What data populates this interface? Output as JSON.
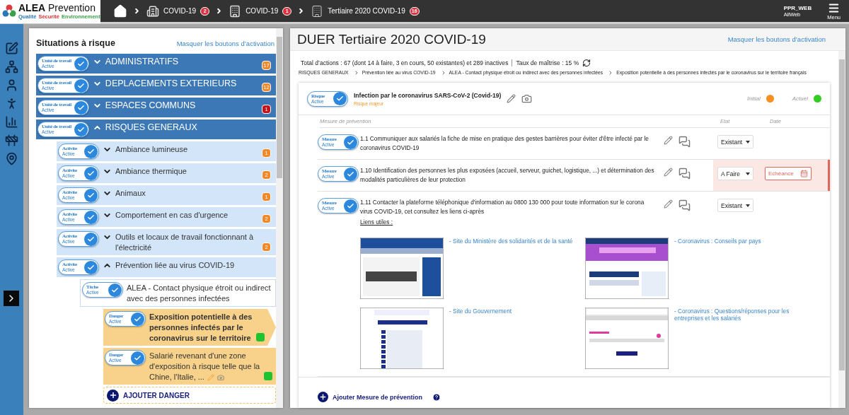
{
  "topbar": {
    "logo": {
      "name": "**ALEA** Prevention",
      "tagline": [
        {
          "text": "Qualité",
          "color": "#2a78b8"
        },
        {
          "text": "Sécurité",
          "color": "#d9343a"
        },
        {
          "text": "Environnement",
          "color": "#3aa04a"
        }
      ]
    },
    "breadcrumbs": [
      {
        "label": "COVID-19",
        "count": "2"
      },
      {
        "label": "COVID-19",
        "count": "1"
      },
      {
        "label": "Tertiaire 2020 COVID-19",
        "count": "16"
      }
    ],
    "user": {
      "login": "PPR_WEB",
      "org": "AllWeb"
    },
    "menu_label": "Menu"
  },
  "left_panel": {
    "title": "Situations à risque",
    "hide_link": "Masquer les boutons d’activation",
    "units": [
      {
        "kind": "unit",
        "toggle": {
          "label": "Unité de travail",
          "status": "Active",
          "on": true
        },
        "name": "ADMINISTRATIFS",
        "expanded": false,
        "count": "17",
        "color": "#f0892a"
      },
      {
        "kind": "unit",
        "toggle": {
          "label": "Unité de travail",
          "status": "Active",
          "on": true
        },
        "name": "DEPLACEMENTS EXTERIEURS",
        "expanded": false,
        "count": "12",
        "color": "#f0892a"
      },
      {
        "kind": "unit",
        "toggle": {
          "label": "Unité de travail",
          "status": "Active",
          "on": true
        },
        "name": "ESPACES COMMUNS",
        "expanded": false,
        "count": "1",
        "color": "#c3161c"
      },
      {
        "kind": "unit",
        "toggle": {
          "label": "Unité de travail",
          "status": "Active",
          "on": true
        },
        "name": "RISQUES GENERAUX",
        "expanded": true,
        "children": [
          {
            "kind": "activity",
            "toggle": {
              "label": "Activite",
              "status": "Active",
              "on": true
            },
            "name": "Ambiance lumineuse",
            "expanded": false,
            "count": "1",
            "color": "#f0892a"
          },
          {
            "kind": "activity",
            "toggle": {
              "label": "Activite",
              "status": "Active",
              "on": true
            },
            "name": "Ambiance thermique",
            "expanded": false,
            "count": "2",
            "color": "#f0892a"
          },
          {
            "kind": "activity",
            "toggle": {
              "label": "Activite",
              "status": "Active",
              "on": true
            },
            "name": "Animaux",
            "expanded": false,
            "count": "1",
            "color": "#f0892a"
          },
          {
            "kind": "activity",
            "toggle": {
              "label": "Activite",
              "status": "Active",
              "on": true
            },
            "name": "Comportement en cas d'urgence",
            "expanded": false,
            "count": "2",
            "color": "#f0892a"
          },
          {
            "kind": "activity",
            "toggle": {
              "label": "Activite",
              "status": "Active",
              "on": true
            },
            "name": "Outils et locaux de travail fonctionnant à l'électricité",
            "expanded": false,
            "count": "2",
            "color": "#f0892a"
          },
          {
            "kind": "activity",
            "toggle": {
              "label": "Activite",
              "status": "Active",
              "on": true
            },
            "name": "Prévention liée au virus COVID-19",
            "expanded": true,
            "children": [
              {
                "kind": "task",
                "toggle": {
                  "label": "Tâche",
                  "status": "Active",
                  "on": true
                },
                "name": "ALEA - Contact physique étroit ou indirect avec des personnes infectées",
                "children": [
                  {
                    "kind": "danger",
                    "toggle": {
                      "label": "Danger",
                      "status": "Active",
                      "on": true
                    },
                    "name": "Exposition potentielle à des personnes infectés par le coronavirus sur le territoire",
                    "selected": true,
                    "color": "#1fc32f",
                    "show_actions": false
                  },
                  {
                    "kind": "danger",
                    "toggle": {
                      "label": "Danger",
                      "status": "Active",
                      "on": true
                    },
                    "name": "Salarié revenant d'une zone d'exposition à risque telle que la Chine, l'Italie, ...",
                    "selected": false,
                    "color": "#1fc32f",
                    "show_actions": true
                  }
                ]
              }
            ]
          }
        ]
      }
    ],
    "add_danger": "AJOUTER DANGER"
  },
  "document": {
    "title": "DUER Tertiaire 2020 COVID-19",
    "hide_link": "Masquer les boutons d’activation",
    "summary": "Total d’actions : 67 (dont 14 à faire, 3 en cours, 50 existantes) et 289 inactives",
    "mastery": "Taux de maîtrise : 15 %",
    "path": [
      "RISQUES GENERAUX",
      "Prévention liée au virus COVID-19",
      "ALEA - Contact physique étroit ou indirect avec des personnes infectées",
      "Exposition potentielle à des personnes infectés par le coronavirus sur le territoire français"
    ],
    "risk": {
      "toggle": {
        "label": "Risque",
        "status": "Active",
        "on": true
      },
      "title": "Infection par le coronavirus SARS-CoV-2 (Covid-19)",
      "severity": "Risque majeur",
      "indicators": [
        {
          "label": "Initial",
          "color": "#f7901e"
        },
        {
          "label": "Actuel",
          "color": "#33cc22"
        }
      ]
    },
    "columns": [
      "Mesure de prévention",
      "Etat",
      "Date"
    ],
    "measures": [
      {
        "toggle": {
          "label": "Mesure",
          "status": "Active",
          "on": true
        },
        "text": "1.1 Communiquer aux salariés la fiche de mise en pratique des gestes barrières pour éviter d'être infecté par le coronavirus COVID-19",
        "state": "Existant",
        "overdue": false
      },
      {
        "toggle": {
          "label": "Mesure",
          "status": "Active",
          "on": true
        },
        "text": "1.10 Identification des personnes les plus exposées (accueil, serveur, guichet, logistique, ...) et détermination des modalités particulières de leur protection",
        "state": "A Faire",
        "overdue": true,
        "due_button": "Echéance"
      },
      {
        "toggle": {
          "label": "Mesure",
          "status": "Active",
          "on": true
        },
        "text": "1.11 Contacter la plateforme téléphonique d'information au 0800 130 000 pour toute information sur le corona virus COVID-19, cet consultez les liens ci-après",
        "state": "Existant",
        "overdue": false,
        "links_title": "Liens utiles :",
        "links": [
          {
            "label": "- Site du Ministère des solidarités et de la santé",
            "kind": "picture"
          },
          {
            "label": "- Coronavirus : Conseils par pays",
            "kind": "picture"
          },
          {
            "label": "- Site du Gouvernement",
            "kind": "picture"
          },
          {
            "label": "- Coronavirus : Questions/réponses pour les entreprises et les salariés",
            "kind": "picture"
          }
        ]
      }
    ],
    "add_measure": "Ajouter Mesure de prévention"
  }
}
